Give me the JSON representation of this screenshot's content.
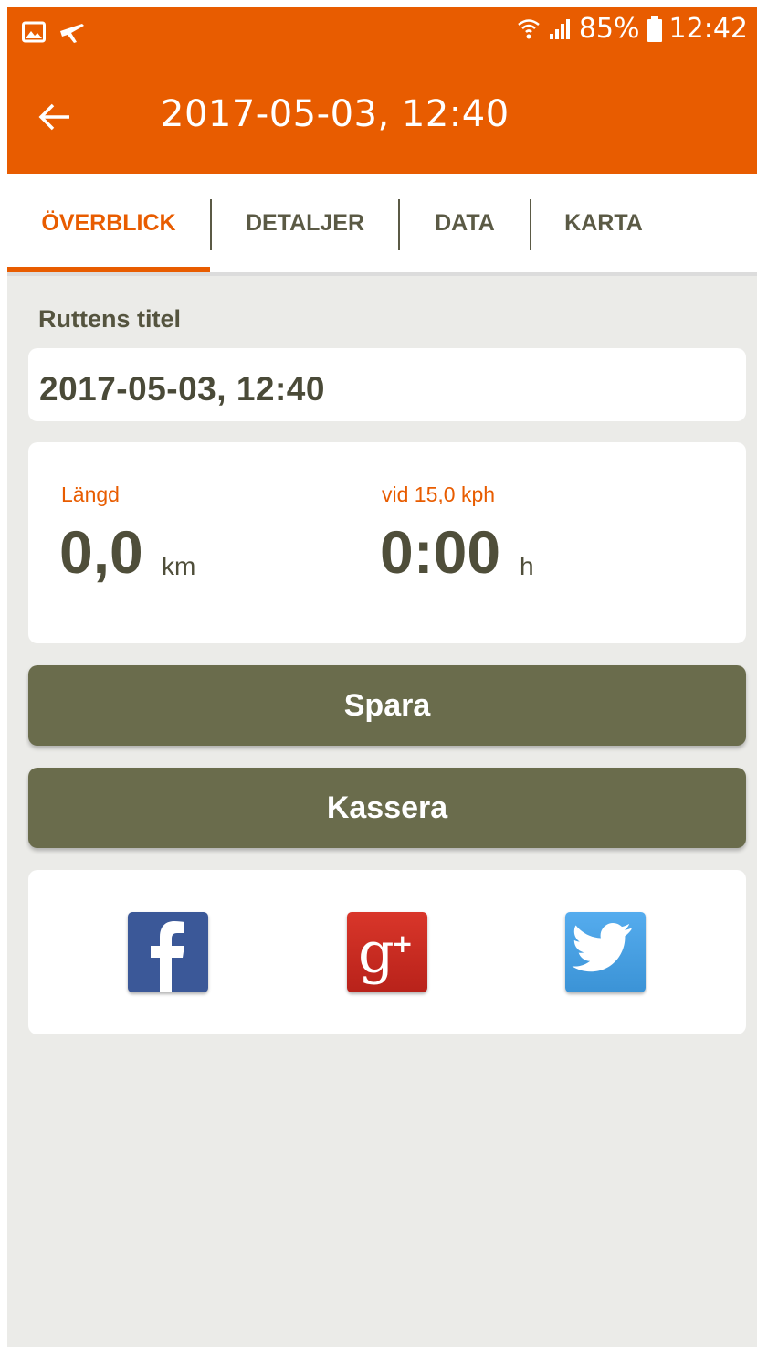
{
  "status_bar": {
    "left_icons": [
      "image-icon",
      "plane-icon"
    ],
    "battery_percent": "85%",
    "time": "12:42"
  },
  "app_bar": {
    "title": "2017-05-03, 12:40",
    "back_icon": "arrow-left-icon"
  },
  "tabs": [
    {
      "label": "ÖVERBLICK",
      "active": true
    },
    {
      "label": "DETALJER",
      "active": false
    },
    {
      "label": "DATA",
      "active": false
    },
    {
      "label": "KARTA",
      "active": false
    }
  ],
  "route": {
    "section_label": "Ruttens titel",
    "title_value": "2017-05-03, 12:40"
  },
  "stats": {
    "length": {
      "label": "Längd",
      "value": "0,0",
      "unit": "km"
    },
    "duration": {
      "label": "vid 15,0 kph",
      "value": "0:00",
      "unit": "h"
    }
  },
  "actions": {
    "save_label": "Spara",
    "discard_label": "Kassera"
  },
  "share": {
    "networks": [
      "facebook-icon",
      "google-plus-icon",
      "twitter-icon"
    ]
  },
  "colors": {
    "accent": "#e85c00",
    "button": "#6a6c4c",
    "text_dark": "#4f4e3a",
    "background": "#ebebe8"
  }
}
